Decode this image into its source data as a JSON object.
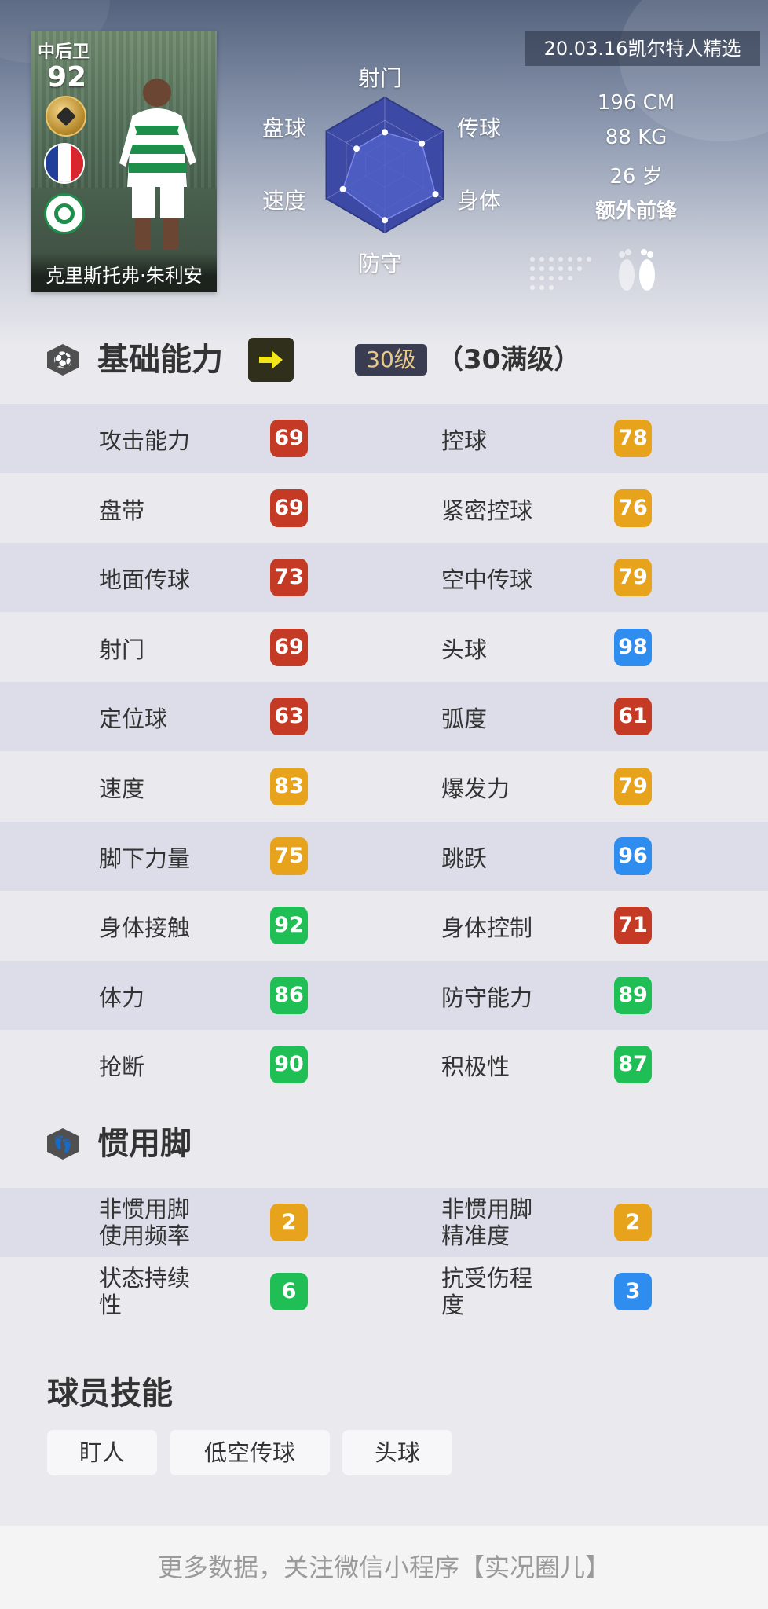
{
  "player_card": {
    "position": "中后卫",
    "rating": "92",
    "name": "克里斯托弗·朱利安",
    "flag_colors": [
      "#1f3f9a",
      "#ffffff",
      "#d9262e"
    ]
  },
  "radar": {
    "labels": [
      "射门",
      "传球",
      "身体",
      "防守",
      "速度",
      "盘球"
    ],
    "values": [
      69,
      78,
      92,
      89,
      83,
      69
    ],
    "fill_color": "#4f5fc4"
  },
  "info": {
    "tag": "20.03.16凯尔特人精选",
    "height": "196 CM",
    "weight": "88 KG",
    "age": "26 岁",
    "role": "额外前锋"
  },
  "basic": {
    "title": "基础能力",
    "level_badge": "30级",
    "level_text": "（30满级）",
    "rows": [
      {
        "left": {
          "label": "攻击能力",
          "value": "69",
          "color": "red"
        },
        "right": {
          "label": "控球",
          "value": "78",
          "color": "orange"
        }
      },
      {
        "left": {
          "label": "盘带",
          "value": "69",
          "color": "red"
        },
        "right": {
          "label": "紧密控球",
          "value": "76",
          "color": "orange"
        }
      },
      {
        "left": {
          "label": "地面传球",
          "value": "73",
          "color": "red"
        },
        "right": {
          "label": "空中传球",
          "value": "79",
          "color": "orange"
        }
      },
      {
        "left": {
          "label": "射门",
          "value": "69",
          "color": "red"
        },
        "right": {
          "label": "头球",
          "value": "98",
          "color": "blue"
        }
      },
      {
        "left": {
          "label": "定位球",
          "value": "63",
          "color": "red"
        },
        "right": {
          "label": "弧度",
          "value": "61",
          "color": "red"
        }
      },
      {
        "left": {
          "label": "速度",
          "value": "83",
          "color": "orange"
        },
        "right": {
          "label": "爆发力",
          "value": "79",
          "color": "orange"
        }
      },
      {
        "left": {
          "label": "脚下力量",
          "value": "75",
          "color": "orange"
        },
        "right": {
          "label": "跳跃",
          "value": "96",
          "color": "blue"
        }
      },
      {
        "left": {
          "label": "身体接触",
          "value": "92",
          "color": "green"
        },
        "right": {
          "label": "身体控制",
          "value": "71",
          "color": "red"
        }
      },
      {
        "left": {
          "label": "体力",
          "value": "86",
          "color": "green"
        },
        "right": {
          "label": "防守能力",
          "value": "89",
          "color": "green"
        }
      },
      {
        "left": {
          "label": "抢断",
          "value": "90",
          "color": "green"
        },
        "right": {
          "label": "积极性",
          "value": "87",
          "color": "green"
        }
      }
    ]
  },
  "foot": {
    "title": "惯用脚",
    "rows": [
      {
        "left": {
          "label_l1": "非惯用脚",
          "label_l2": "使用频率",
          "value": "2",
          "color": "orange"
        },
        "right": {
          "label_l1": "非惯用脚",
          "label_l2": "精准度",
          "value": "2",
          "color": "orange"
        }
      },
      {
        "left": {
          "label_l1": "状态持续",
          "label_l2": "性",
          "value": "6",
          "color": "green"
        },
        "right": {
          "label_l1": "抗受伤程",
          "label_l2": "度",
          "value": "3",
          "color": "blue"
        }
      }
    ]
  },
  "skills": {
    "title": "球员技能",
    "items": [
      "盯人",
      "低空传球",
      "头球"
    ]
  },
  "footer": {
    "text": "更多数据，关注微信小程序【实况圈儿】"
  }
}
